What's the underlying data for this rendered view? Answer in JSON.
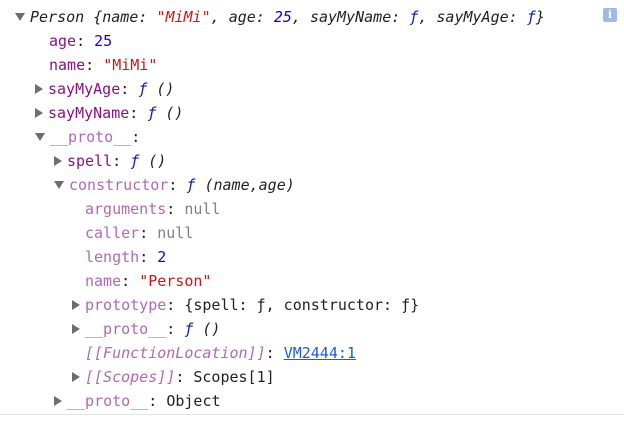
{
  "summary": {
    "class_name": "Person",
    "open_brace": "{",
    "close_brace": "}",
    "name_key": "name",
    "name_value": "\"MiMi\"",
    "age_key": "age",
    "age_value": "25",
    "say_name_key": "sayMyName",
    "say_age_key": "sayMyAge",
    "func_symbol": "ƒ",
    "colon": ":",
    "comma": ","
  },
  "info_icon": "info-icon",
  "rows": {
    "age": {
      "key": "age",
      "value": "25"
    },
    "name": {
      "key": "name",
      "value": "\"MiMi\""
    },
    "sayMyAge": {
      "key": "sayMyAge",
      "value": "()"
    },
    "sayMyName": {
      "key": "sayMyName",
      "value": "()"
    },
    "proto": {
      "key": "__proto__"
    },
    "spell": {
      "key": "spell",
      "value": "()"
    },
    "constructor": {
      "key": "constructor",
      "value": "(name,age)"
    },
    "arguments": {
      "key": "arguments",
      "value": "null"
    },
    "caller": {
      "key": "caller",
      "value": "null"
    },
    "length": {
      "key": "length",
      "value": "2"
    },
    "cname": {
      "key": "name",
      "value": "\"Person\""
    },
    "prototype": {
      "key": "prototype",
      "value": "{spell: ƒ, constructor: ƒ}"
    },
    "cproto": {
      "key": "__proto__",
      "value": "()"
    },
    "funcloc": {
      "key": "[[FunctionLocation]]",
      "value": "VM2444:1"
    },
    "scopes": {
      "key": "[[Scopes]]",
      "value": "Scopes[1]"
    },
    "protoObj": {
      "key": "__proto__",
      "value": "Object"
    }
  },
  "colors": {
    "key": "#881280",
    "key_dim": "#b069b5",
    "string": "#c41a16",
    "number": "#1c00cf",
    "null": "#808080",
    "function_keyword": "#0d22aa",
    "link": "#1a5fd0"
  }
}
